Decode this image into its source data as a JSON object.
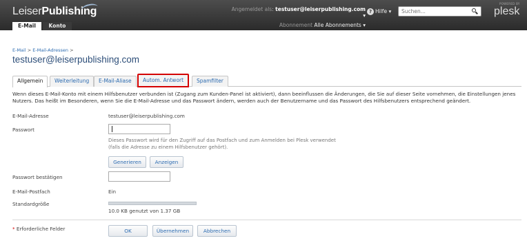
{
  "header": {
    "logo_light": "Leiser",
    "logo_bold": "Publishing",
    "session_label": "Angemeldet als",
    "session_user": "testuser@leiserpublishing.com ▾",
    "subscription_label": "Abonnement",
    "subscription_value": "Alle Abonnements ▾",
    "help_label": "Hilfe ▾",
    "search_placeholder": "Suchen...",
    "powered_by": "POWERED BY",
    "brand": "plesk"
  },
  "top_tabs": [
    "E-Mail",
    "Konto"
  ],
  "breadcrumb": [
    "E-Mail",
    "E-Mail-Adressen"
  ],
  "page_title": "testuser@leiserpublishing.com",
  "tabs": [
    "Allgemein",
    "Weiterleitung",
    "E-Mail-Aliase",
    "Autom. Antwort",
    "Spamfilter"
  ],
  "intro": "Wenn dieses E-Mail-Konto mit einem Hilfsbenutzer verbunden ist (Zugang zum Kunden-Panel ist aktiviert), dann beeinflussen die Änderungen, die Sie auf dieser Seite vornehmen, die Einstellungen jenes Nutzers. Das heißt im Besonderen, wenn Sie die E-Mail-Adresse und das Passwort ändern, werden auch der Benutzername und das Passwort des Hilfsbenutzers entsprechend geändert.",
  "form": {
    "email_label": "E-Mail-Adresse",
    "email_value": "testuser@leiserpublishing.com",
    "password_label": "Passwort",
    "password_value": "",
    "password_hint": "Dieses Passwort wird für den Zugriff auf das Postfach und zum Anmelden bei Plesk verwendet (falls die Adresse zu einem Hilfsbenutzer gehört).",
    "generate_button": "Generieren",
    "show_button": "Anzeigen",
    "confirm_label": "Passwort bestätigen",
    "confirm_value": "",
    "mailbox_label": "E-Mail-Postfach",
    "mailbox_value": "Ein",
    "size_label": "Standardgröße",
    "quota_text": "10.0 KB genutzt von 1.37 GB",
    "quota_fraction": 0.0
  },
  "footer": {
    "required_star": "*",
    "required_text": "Erforderliche Felder",
    "ok_button": "OK",
    "apply_button": "Übernehmen",
    "cancel_button": "Abbrechen"
  },
  "colors": {
    "highlight_border": "#d40000",
    "link": "#2c6bb0",
    "title": "#2e4f7a"
  }
}
